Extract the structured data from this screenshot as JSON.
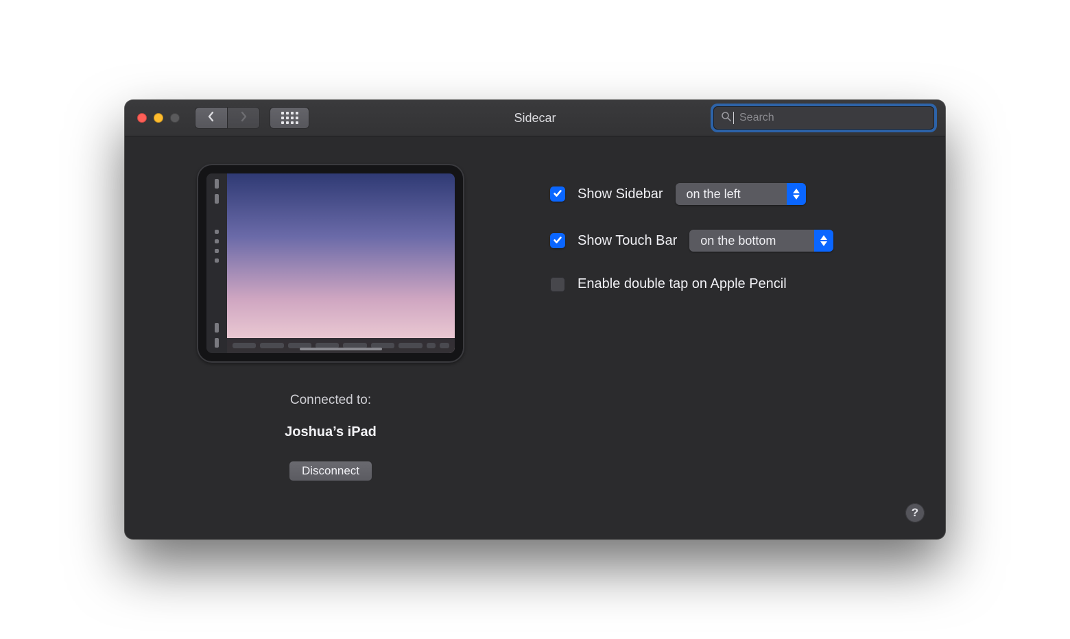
{
  "window": {
    "title": "Sidecar"
  },
  "toolbar": {
    "search_placeholder": "Search"
  },
  "preview": {
    "connected_label": "Connected to:",
    "device_name": "Joshua’s iPad",
    "disconnect_label": "Disconnect"
  },
  "options": {
    "show_sidebar": {
      "label": "Show Sidebar",
      "checked": true,
      "value": "on the left"
    },
    "show_touchbar": {
      "label": "Show Touch Bar",
      "checked": true,
      "value": "on the bottom"
    },
    "double_tap": {
      "label": "Enable double tap on Apple Pencil",
      "checked": false
    }
  },
  "help": {
    "label": "?"
  }
}
